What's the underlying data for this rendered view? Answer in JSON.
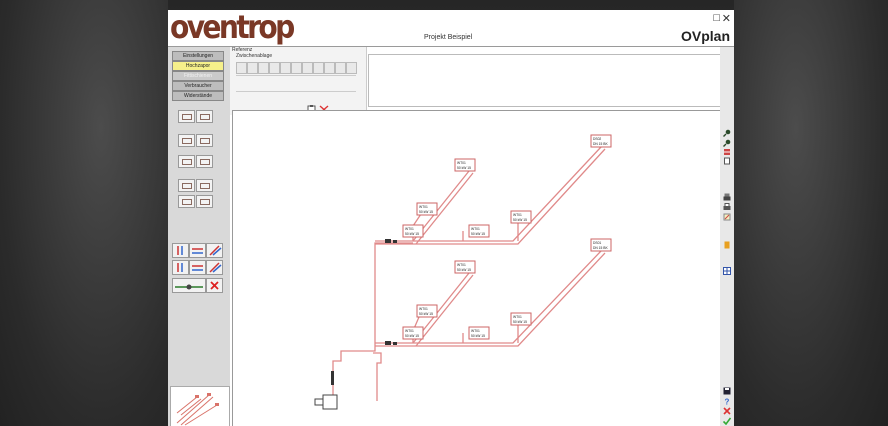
{
  "app": {
    "logo": "oventrop",
    "project_title": "Projekt Beispiel",
    "product_name": "OVplan"
  },
  "window_controls": {
    "minimize": "□",
    "close": "✕"
  },
  "menu": {
    "items": [
      {
        "label": "Einstellungen",
        "state": "normal"
      },
      {
        "label": "Hochzapor",
        "state": "active"
      },
      {
        "label": "Fittischienen",
        "state": "dim"
      },
      {
        "label": "Verbraucher",
        "state": "normal"
      },
      {
        "label": "Widerstände",
        "state": "normal"
      }
    ]
  },
  "reference": {
    "label": "Referenz",
    "sub_label": "Zwischenablage"
  },
  "diagram": {
    "nodes": [
      {
        "line1": "DS02",
        "line2": "DN 15 BK"
      },
      {
        "line1": "WT01",
        "line2": "50 kW 15"
      },
      {
        "line1": "WT01",
        "line2": "50 kW 15"
      },
      {
        "line1": "WT01",
        "line2": "50 kW 15"
      },
      {
        "line1": "WT01",
        "line2": "50 kW 15"
      },
      {
        "line1": "WT01",
        "line2": "50 kW 15"
      },
      {
        "line1": "DS01",
        "line2": "DN 15 BK"
      },
      {
        "line1": "WT01",
        "line2": "50 kW 15"
      },
      {
        "line1": "WT01",
        "line2": "50 kW 15"
      },
      {
        "line1": "WT01",
        "line2": "50 kW 15"
      },
      {
        "line1": "WT01",
        "line2": "50 kW 15"
      },
      {
        "line1": "WT01",
        "line2": "50 kW 15"
      }
    ]
  },
  "colors": {
    "pipe": "#e08a8a",
    "logo": "#7a3826",
    "highlight": "#f6f08a"
  }
}
